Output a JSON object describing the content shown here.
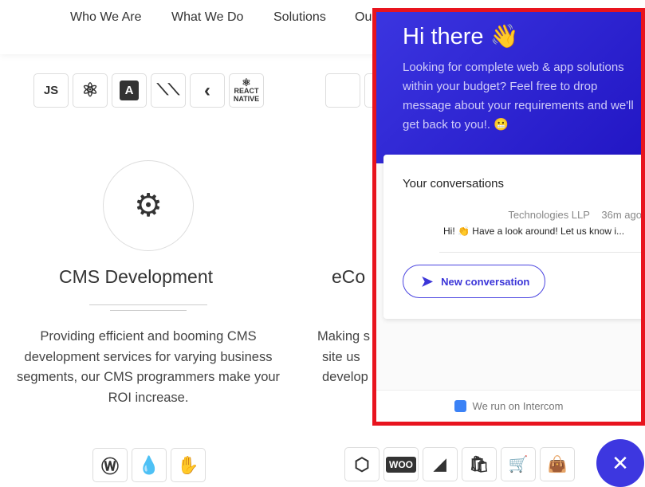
{
  "nav": {
    "items": [
      "Who We Are",
      "What We Do",
      "Solutions",
      "Ou"
    ]
  },
  "tech_icons_top": [
    "nodejs-icon",
    "react-icon",
    "angular-icon",
    "meteor-icon",
    "flutter-icon",
    "react-native-icon",
    "apple-icon"
  ],
  "react_native_label": "REACT NATIVE",
  "cms": {
    "title": "CMS Development",
    "text": "Providing efficient and booming CMS development services for varying business segments, our CMS programmers make your ROI increase."
  },
  "ecom": {
    "title": "eCo",
    "lines": [
      "Making s",
      "site us",
      "develop"
    ]
  },
  "bottom_icons_left": [
    "wordpress-icon",
    "drupal-icon",
    "joomla-icon"
  ],
  "bottom_icons_right": [
    "magento-icon",
    "woocommerce-icon",
    "bigcommerce-icon",
    "shopify-icon",
    "opencart-icon",
    "prestashop-icon"
  ],
  "woo_label": "WOO",
  "chat": {
    "greeting": "Hi there 👋",
    "intro": "Looking for complete web & app solutions within your budget? Feel free to drop message about your requirements and we'll get back to you!. 😬",
    "conversations_title": "Your conversations",
    "sender": "Technologies LLP",
    "time": "36m ago",
    "preview": "Hi! 👏  Have a look around! Let us know i...",
    "new_conversation": "New conversation",
    "footer": "We run on Intercom",
    "close": "✕",
    "accent": "#3d37e0",
    "highlight_border": "#e8141e"
  }
}
